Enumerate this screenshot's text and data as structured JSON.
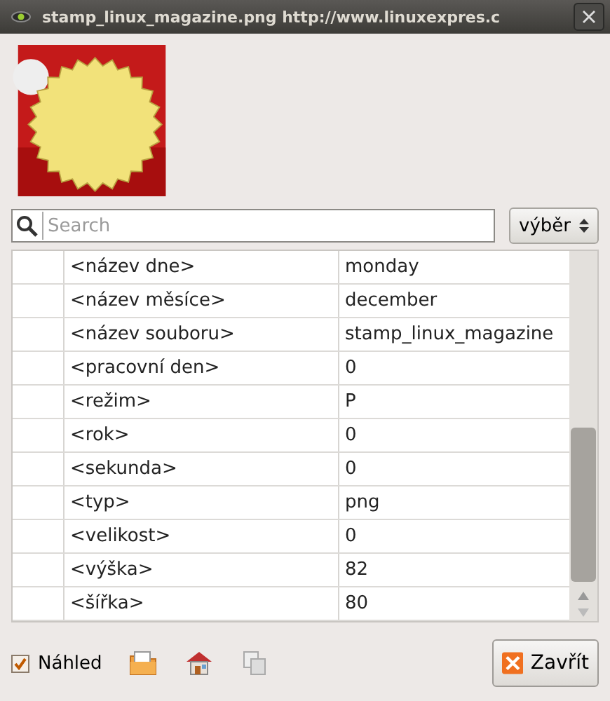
{
  "window": {
    "title": "stamp_linux_magazine.png http://www.linuxexpres.c"
  },
  "search": {
    "placeholder": "Search"
  },
  "select": {
    "value": "výběr"
  },
  "table": {
    "rows": [
      {
        "tag": "<název dne>",
        "value": "monday"
      },
      {
        "tag": "<název měsíce>",
        "value": "december"
      },
      {
        "tag": "<název souboru>",
        "value": "stamp_linux_magazine"
      },
      {
        "tag": "<pracovní den>",
        "value": "0"
      },
      {
        "tag": "<režim>",
        "value": "P"
      },
      {
        "tag": "<rok>",
        "value": "0"
      },
      {
        "tag": "<sekunda>",
        "value": "0"
      },
      {
        "tag": "<typ>",
        "value": "png"
      },
      {
        "tag": "<velikost>",
        "value": "0"
      },
      {
        "tag": "<výška>",
        "value": "82"
      },
      {
        "tag": "<šířka>",
        "value": "80"
      }
    ]
  },
  "preview": {
    "label": "Náhled",
    "checked": true
  },
  "close_button": {
    "label": "Zavřít"
  }
}
